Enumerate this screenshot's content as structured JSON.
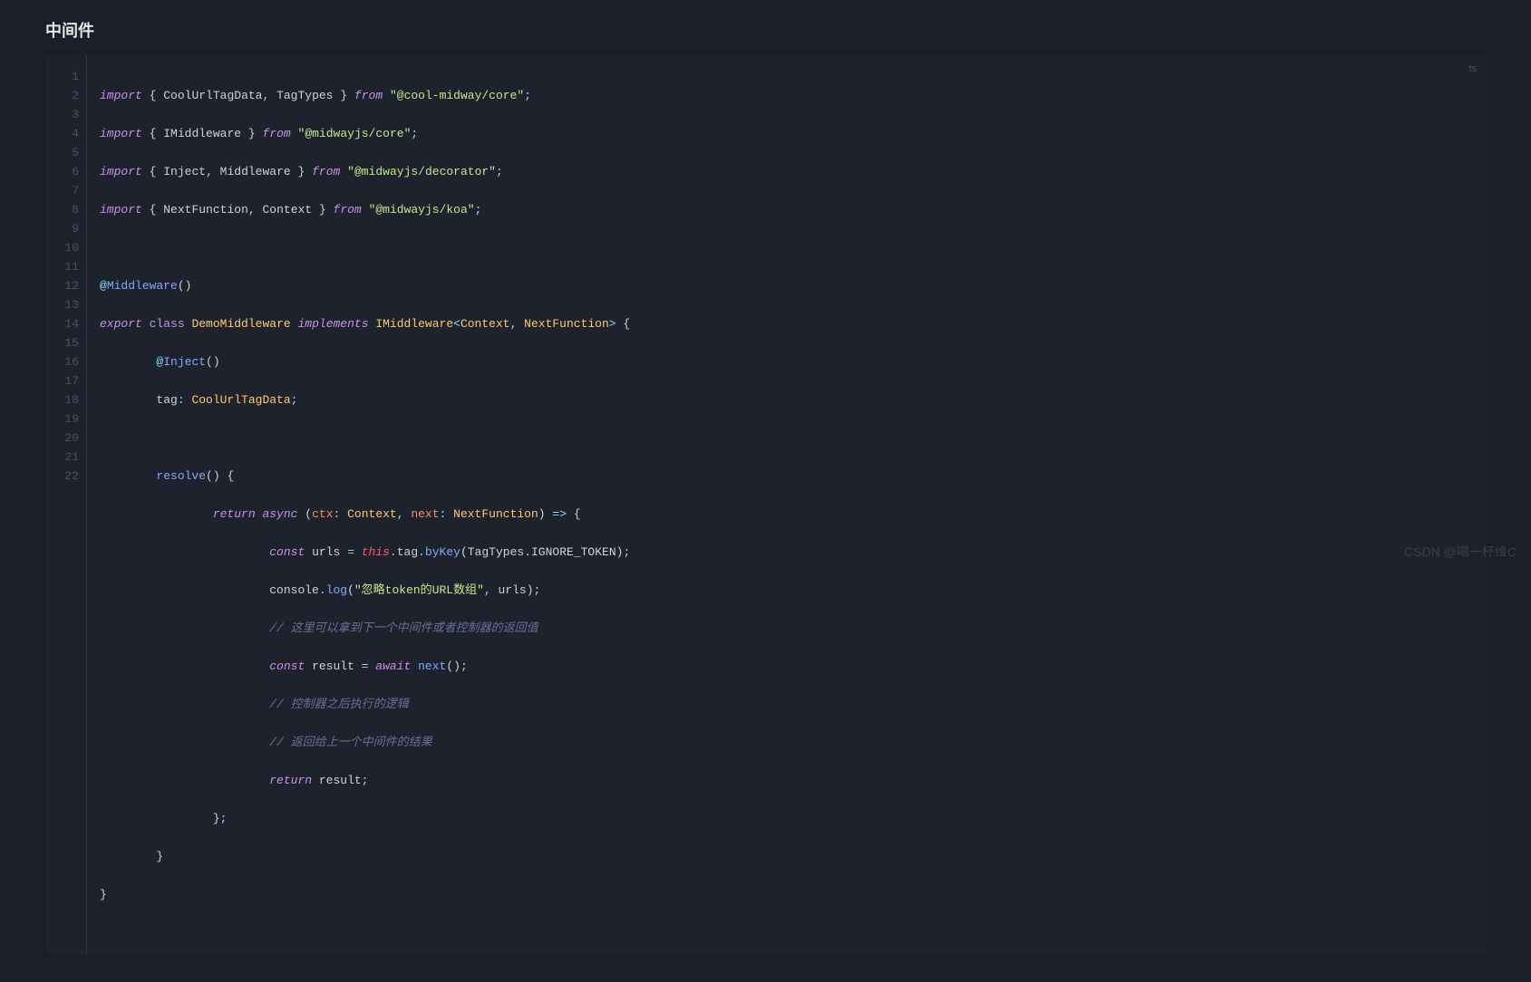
{
  "title": "中间件",
  "language_tag": "ts",
  "watermark": "CSDN @喝一杯维C",
  "lines": {
    "l1": {
      "n": "1"
    },
    "l2": {
      "n": "2"
    },
    "l3": {
      "n": "3"
    },
    "l4": {
      "n": "4"
    },
    "l5": {
      "n": "5"
    },
    "l6": {
      "n": "6"
    },
    "l7": {
      "n": "7"
    },
    "l8": {
      "n": "8"
    },
    "l9": {
      "n": "9"
    },
    "l10": {
      "n": "10"
    },
    "l11": {
      "n": "11"
    },
    "l12": {
      "n": "12"
    },
    "l13": {
      "n": "13"
    },
    "l14": {
      "n": "14"
    },
    "l15": {
      "n": "15"
    },
    "l16": {
      "n": "16"
    },
    "l17": {
      "n": "17"
    },
    "l18": {
      "n": "18"
    },
    "l19": {
      "n": "19"
    },
    "l20": {
      "n": "20"
    },
    "l21": {
      "n": "21"
    },
    "l22": {
      "n": "22"
    }
  },
  "tok": {
    "import": "import",
    "from": "from",
    "export": "export",
    "class": "class",
    "implements": "implements",
    "return": "return",
    "async": "async",
    "const": "const",
    "await": "await",
    "this": "this",
    "CoolUrlTagData": "CoolUrlTagData",
    "TagTypes": "TagTypes",
    "IMiddleware": "IMiddleware",
    "Inject": "Inject",
    "Middleware": "Middleware",
    "NextFunction": "NextFunction",
    "Context": "Context",
    "DemoMiddleware": "DemoMiddleware",
    "tag": "tag",
    "resolve": "resolve",
    "ctx": "ctx",
    "next": "next",
    "urls": "urls",
    "byKey": "byKey",
    "IGNORE_TOKEN": "IGNORE_TOKEN",
    "console": "console",
    "log": "log",
    "result": "result",
    "str_coolmidway": "\"@cool-midway/core\"",
    "str_midwaycore": "\"@midwayjs/core\"",
    "str_midwaydecorator": "\"@midwayjs/decorator\"",
    "str_midwaykoa": "\"@midwayjs/koa\"",
    "str_ignoretoken": "\"忽略token的URL数组\"",
    "cmt1": "// 这里可以拿到下一个中间件或者控制器的返回值",
    "cmt2": "// 控制器之后执行的逻辑",
    "cmt3": "// 返回给上一个中间件的结果",
    "lbrace": "{",
    "rbrace": "}",
    "lparen": "(",
    "rparen": ")",
    "comma": ", ",
    "semi": ";",
    "colon": ": ",
    "dot": ".",
    "lt": "<",
    "gt": ">",
    "eq": " = ",
    "arrow": "=>",
    "at": "@",
    "sp": " "
  }
}
